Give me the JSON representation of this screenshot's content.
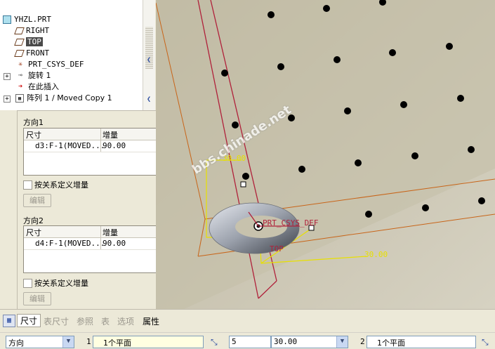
{
  "model_tree": {
    "items": [
      {
        "label": "YHZL.PRT",
        "icon": "part-icon"
      },
      {
        "label": "RIGHT",
        "icon": "datum-plane-icon"
      },
      {
        "label": "TOP",
        "icon": "datum-plane-icon",
        "selected": true
      },
      {
        "label": "FRONT",
        "icon": "datum-plane-icon"
      },
      {
        "label": "PRT_CSYS_DEF",
        "icon": "csys-icon"
      },
      {
        "label": "旋转 1",
        "icon": "revolve-icon"
      },
      {
        "label": "在此插入",
        "icon": "insert-arrow-icon"
      },
      {
        "label": "阵列 1 / Moved Copy 1",
        "icon": "pattern-icon"
      }
    ]
  },
  "panel": {
    "direction1": {
      "title": "方向1",
      "col_dim": "尺寸",
      "col_inc": "增量",
      "rows": [
        {
          "dim": "d3:F-1(MOVED...",
          "inc": "90.00"
        }
      ],
      "checkbox": "按关系定义增量",
      "edit": "编辑"
    },
    "direction2": {
      "title": "方向2",
      "col_dim": "尺寸",
      "col_inc": "增量",
      "rows": [
        {
          "dim": "d4:F-1(MOVED...",
          "inc": "90.00"
        }
      ],
      "checkbox": "按关系定义增量",
      "edit": "编辑"
    }
  },
  "viewport": {
    "watermark": "bbs.chinade.net",
    "dim_top": "30.00",
    "dim_bottom": "30.00",
    "csys_label": "PRT_CSYS_DEF",
    "top_label": "TOP"
  },
  "tabs": [
    {
      "label": "尺寸",
      "active": true
    },
    {
      "label": "表尺寸",
      "active": false
    },
    {
      "label": "参照",
      "active": false
    },
    {
      "label": "表",
      "active": false
    },
    {
      "label": "选项",
      "active": false
    },
    {
      "label": "属性",
      "active": true
    }
  ],
  "toolbar": {
    "type_select": "方向",
    "dir1_num": "1",
    "dir1_ref": "1个平面",
    "count": "5",
    "spacing": "30.00",
    "dir2_num": "2",
    "dir2_ref": "1个平面"
  },
  "colors": {
    "viewport_bg": "#c9c4b0",
    "plane_red": "#b0203a",
    "dim_yellow": "#e8e000",
    "plane_orange": "#c86418"
  }
}
